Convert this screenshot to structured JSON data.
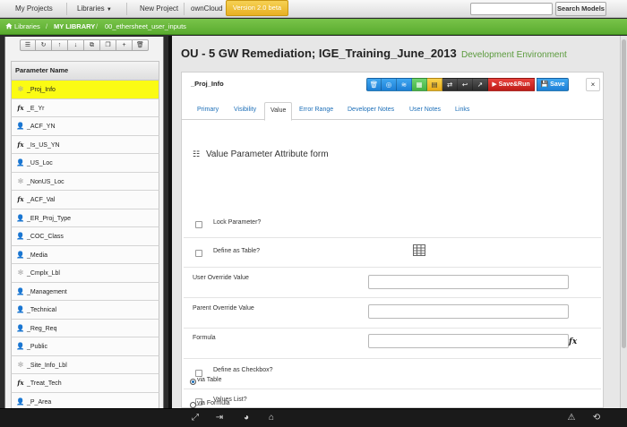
{
  "topnav": {
    "my_projects": "My Projects",
    "libraries": "Libraries",
    "new_project": "New Project",
    "owncloud": "ownCloud",
    "version": "Version 2.0 beta",
    "search_placeholder": "",
    "search_button": "Search Models"
  },
  "breadcrumb": {
    "home_icon": "home-icon",
    "items": [
      "Libraries",
      "MY LIBRARY",
      "00_ethersheet_user_inputs"
    ]
  },
  "sidebar": {
    "toolbar": [
      "list-icon",
      "refresh-icon",
      "arrow-up-icon",
      "arrow-down-icon",
      "copy-icon",
      "duplicate-icon",
      "add-icon",
      "delete-icon"
    ],
    "header": "Parameter Name",
    "items": [
      {
        "label": "_Proj_Info",
        "icon": "gear",
        "selected": true
      },
      {
        "label": "_E_Yr",
        "icon": "fx",
        "selected": false
      },
      {
        "label": "_ACF_YN",
        "icon": "user",
        "selected": false
      },
      {
        "label": "_Is_US_YN",
        "icon": "fx",
        "selected": false
      },
      {
        "label": "_US_Loc",
        "icon": "user",
        "selected": false
      },
      {
        "label": "_NonUS_Loc",
        "icon": "gear",
        "selected": false
      },
      {
        "label": "_ACF_Val",
        "icon": "fx",
        "selected": false
      },
      {
        "label": "_ER_Proj_Type",
        "icon": "user",
        "selected": false
      },
      {
        "label": "_COC_Class",
        "icon": "user",
        "selected": false
      },
      {
        "label": "_Media",
        "icon": "user",
        "selected": false
      },
      {
        "label": "_Cmplx_Lbl",
        "icon": "gear",
        "selected": false
      },
      {
        "label": "_Management",
        "icon": "user",
        "selected": false
      },
      {
        "label": "_Technical",
        "icon": "user",
        "selected": false
      },
      {
        "label": "_Reg_Req",
        "icon": "user",
        "selected": false
      },
      {
        "label": "_Public",
        "icon": "user",
        "selected": false
      },
      {
        "label": "_Site_Info_Lbl",
        "icon": "gear",
        "selected": false
      },
      {
        "label": "_Treat_Tech",
        "icon": "fx",
        "selected": false
      },
      {
        "label": "_P_Area",
        "icon": "user",
        "selected": false
      }
    ]
  },
  "main": {
    "title": "OU - 5 GW Remediation; IGE_Training_June_2013",
    "environment": "Development Environment",
    "panel_title": "_Proj_Info",
    "actions": {
      "icons": [
        "trash-icon",
        "globe-icon",
        "database-icon",
        "table-icon",
        "grid-icon",
        "swap-icon",
        "undo-icon",
        "export-icon"
      ],
      "save_run": "Save&Run",
      "save": "Save",
      "close": "×"
    },
    "tabs": [
      "Primary",
      "Visibility",
      "Value",
      "Error Range",
      "Developer Notes",
      "User Notes",
      "Links"
    ],
    "active_tab": "Value",
    "form": {
      "title": "Value Parameter Attribute form",
      "lock_parameter": "Lock Parameter?",
      "define_table": "Define as Table?",
      "user_override": "User Override Value",
      "parent_override": "Parent Override Value",
      "formula": "Formula",
      "define_checkbox": "Define as Checkbox?",
      "values_list": "Values List?",
      "via_table": "via Table",
      "via_formula": "via Formula"
    }
  },
  "bottombar": {
    "left_icons": [
      "expand-icon",
      "login-icon",
      "palette-icon",
      "home-icon"
    ],
    "right_icons": [
      "warning-icon",
      "logout-icon"
    ]
  },
  "colors": {
    "breadcrumb_green": "#5aab2f",
    "selected_row": "#fbfb14",
    "version_badge": "#e8b022",
    "save_run_red": "#bd1b17",
    "link_blue": "#1d6fb8"
  }
}
